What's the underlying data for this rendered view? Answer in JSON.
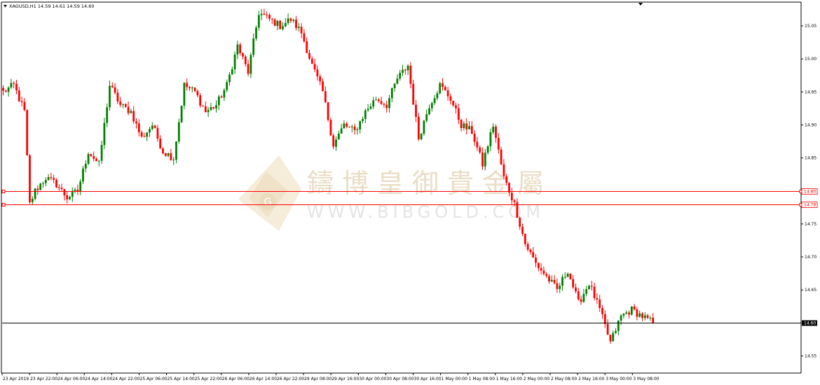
{
  "header": {
    "symbol_info": "XAGUSD,H1  14.59 14.61 14.59 14.60"
  },
  "watermark": {
    "chinese": "鑄博皇御貴金屬",
    "english": "WWW.BIBGOLD.COM",
    "logo_letter": "G"
  },
  "colors": {
    "bull": "#008000",
    "bear": "#ff0000",
    "hline": "#ff0000",
    "price_line": "#000000",
    "axis": "#000000"
  },
  "chart_data": {
    "type": "candlestick",
    "symbol": "XAGUSD",
    "timeframe": "H1",
    "ylim": [
      14.525,
      15.085
    ],
    "y_ticks": [
      {
        "value": 15.05,
        "label": "15.05"
      },
      {
        "value": 15.0,
        "label": "15.00"
      },
      {
        "value": 14.95,
        "label": "14.95"
      },
      {
        "value": 14.9,
        "label": "14.90"
      },
      {
        "value": 14.85,
        "label": "14.85"
      },
      {
        "value": 14.75,
        "label": "14.75"
      },
      {
        "value": 14.7,
        "label": "14.70"
      },
      {
        "value": 14.65,
        "label": "14.65"
      },
      {
        "value": 14.55,
        "label": "14.55"
      }
    ],
    "x_tick_labels": [
      "23 Apr 2019",
      "23 Apr 22:00",
      "24 Apr 06:00",
      "24 Apr 14:00",
      "24 Apr 22:00",
      "25 Apr 06:00",
      "25 Apr 14:00",
      "25 Apr 22:00",
      "26 Apr 06:00",
      "26 Apr 14:00",
      "26 Apr 22:00",
      "29 Apr 08:00",
      "29 Apr 16:00",
      "30 Apr 00:00",
      "30 Apr 08:00",
      "30 Apr 16:00",
      "1 May 00:00",
      "1 May 08:00",
      "1 May 16:00",
      "2 May 00:00",
      "2 May 08:00",
      "2 May 16:00",
      "3 May 00:00",
      "3 May 08:00"
    ],
    "horizontal_lines": [
      {
        "value": 14.8,
        "label": "14.80"
      },
      {
        "value": 14.78,
        "label": "14.78"
      }
    ],
    "current_price": {
      "value": 14.6,
      "label": "14.60"
    },
    "anchors": [
      [
        0,
        14.95
      ],
      [
        4,
        14.96
      ],
      [
        8,
        14.92
      ],
      [
        10,
        14.78
      ],
      [
        12,
        14.8
      ],
      [
        16,
        14.82
      ],
      [
        20,
        14.81
      ],
      [
        24,
        14.79
      ],
      [
        28,
        14.8
      ],
      [
        32,
        14.86
      ],
      [
        36,
        14.84
      ],
      [
        40,
        14.96
      ],
      [
        44,
        14.93
      ],
      [
        48,
        14.92
      ],
      [
        52,
        14.88
      ],
      [
        56,
        14.9
      ],
      [
        60,
        14.86
      ],
      [
        64,
        14.85
      ],
      [
        68,
        14.96
      ],
      [
        72,
        14.95
      ],
      [
        76,
        14.92
      ],
      [
        80,
        14.93
      ],
      [
        84,
        14.96
      ],
      [
        88,
        15.02
      ],
      [
        92,
        14.98
      ],
      [
        96,
        15.07
      ],
      [
        100,
        15.06
      ],
      [
        104,
        15.05
      ],
      [
        108,
        15.06
      ],
      [
        112,
        15.04
      ],
      [
        116,
        14.99
      ],
      [
        120,
        14.95
      ],
      [
        124,
        14.87
      ],
      [
        128,
        14.9
      ],
      [
        132,
        14.89
      ],
      [
        136,
        14.92
      ],
      [
        140,
        14.94
      ],
      [
        144,
        14.93
      ],
      [
        148,
        14.97
      ],
      [
        152,
        14.99
      ],
      [
        156,
        14.88
      ],
      [
        160,
        14.93
      ],
      [
        164,
        14.96
      ],
      [
        168,
        14.94
      ],
      [
        172,
        14.9
      ],
      [
        176,
        14.89
      ],
      [
        180,
        14.84
      ],
      [
        184,
        14.9
      ],
      [
        188,
        14.82
      ],
      [
        192,
        14.78
      ],
      [
        196,
        14.72
      ],
      [
        200,
        14.69
      ],
      [
        204,
        14.67
      ],
      [
        208,
        14.65
      ],
      [
        212,
        14.68
      ],
      [
        216,
        14.63
      ],
      [
        220,
        14.66
      ],
      [
        224,
        14.62
      ],
      [
        228,
        14.57
      ],
      [
        232,
        14.61
      ],
      [
        236,
        14.62
      ],
      [
        240,
        14.61
      ],
      [
        244,
        14.6
      ]
    ]
  }
}
